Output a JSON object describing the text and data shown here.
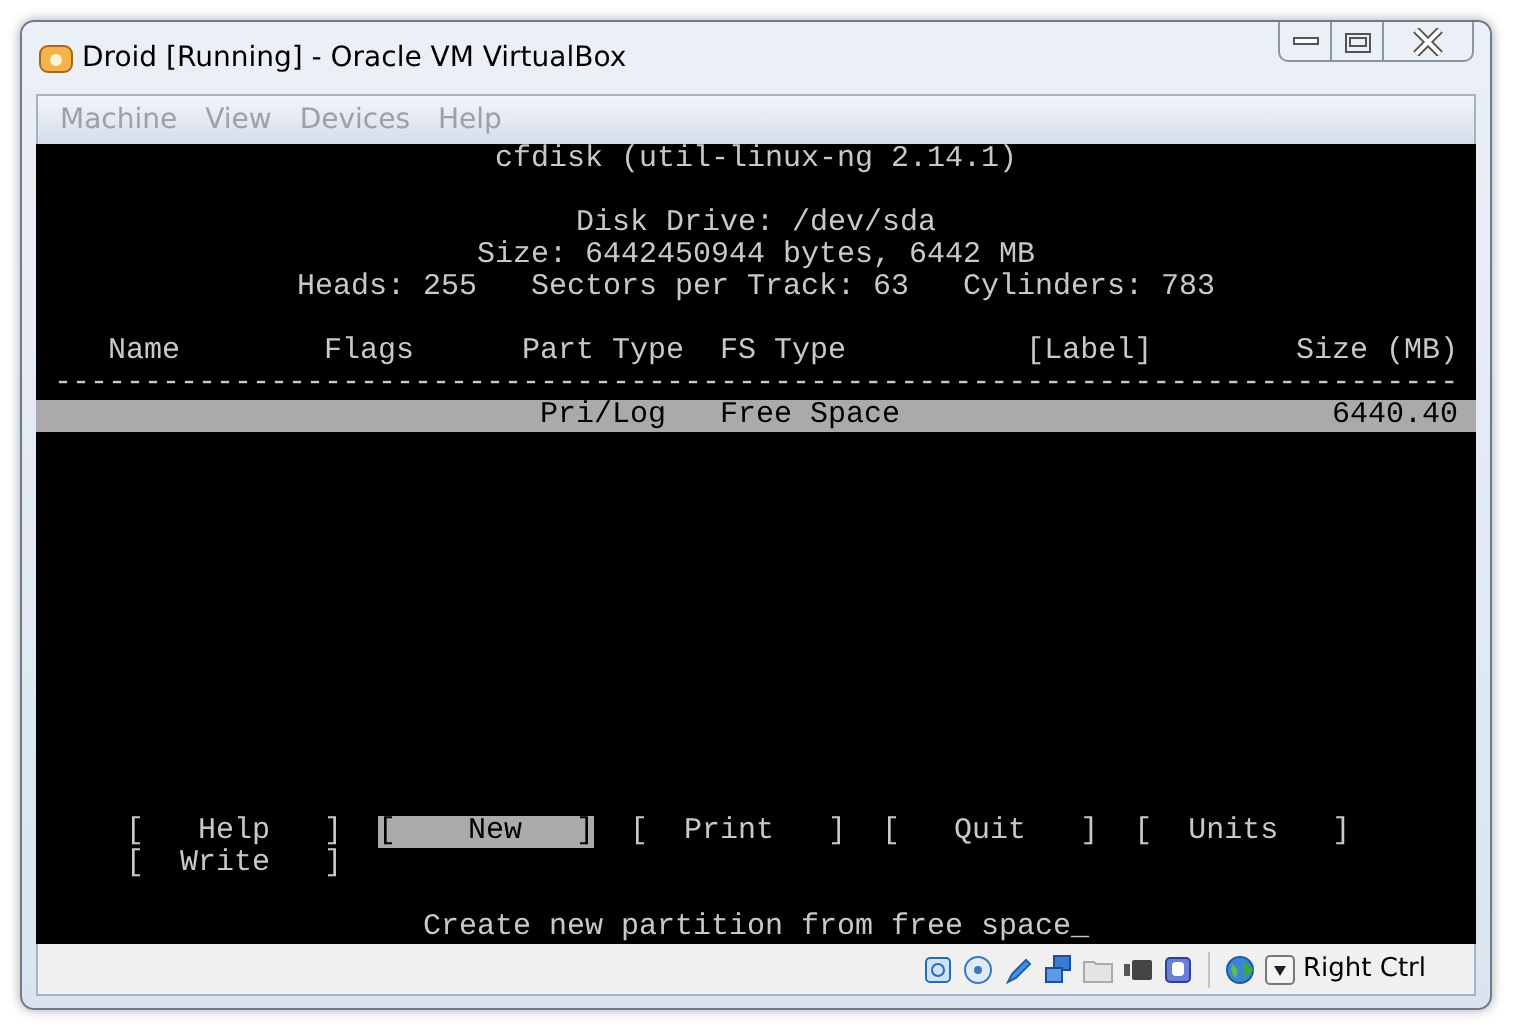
{
  "window": {
    "title": "Droid [Running] - Oracle VM VirtualBox"
  },
  "menu": [
    "Machine",
    "View",
    "Devices",
    "Help"
  ],
  "console": {
    "title": "cfdisk (util-linux-ng 2.14.1)",
    "disk_info": [
      "Disk Drive: /dev/sda",
      "Size: 6442450944 bytes, 6442 MB",
      "Heads: 255   Sectors per Track: 63   Cylinders: 783"
    ],
    "columns": [
      "Name",
      "Flags",
      "Part Type",
      "FS Type",
      "[Label]",
      "Size (MB)"
    ],
    "separator": "------------------------------------------------------------------------------",
    "rows": [
      {
        "selected": true,
        "cells": [
          "",
          "",
          "Pri/Log",
          "Free Space",
          "",
          "6440.40"
        ]
      }
    ],
    "commands": [
      {
        "label": "[   Help   ]",
        "selected": false
      },
      {
        "label": "[    New   ]",
        "selected": true
      },
      {
        "label": "[  Print   ]",
        "selected": false
      },
      {
        "label": "[   Quit   ]",
        "selected": false
      },
      {
        "label": "[  Units   ]",
        "selected": false
      },
      {
        "label": "[  Write   ]",
        "selected": false
      }
    ],
    "message": "Create new partition from free space_"
  },
  "status_bar": {
    "host_key": "Right Ctrl"
  }
}
